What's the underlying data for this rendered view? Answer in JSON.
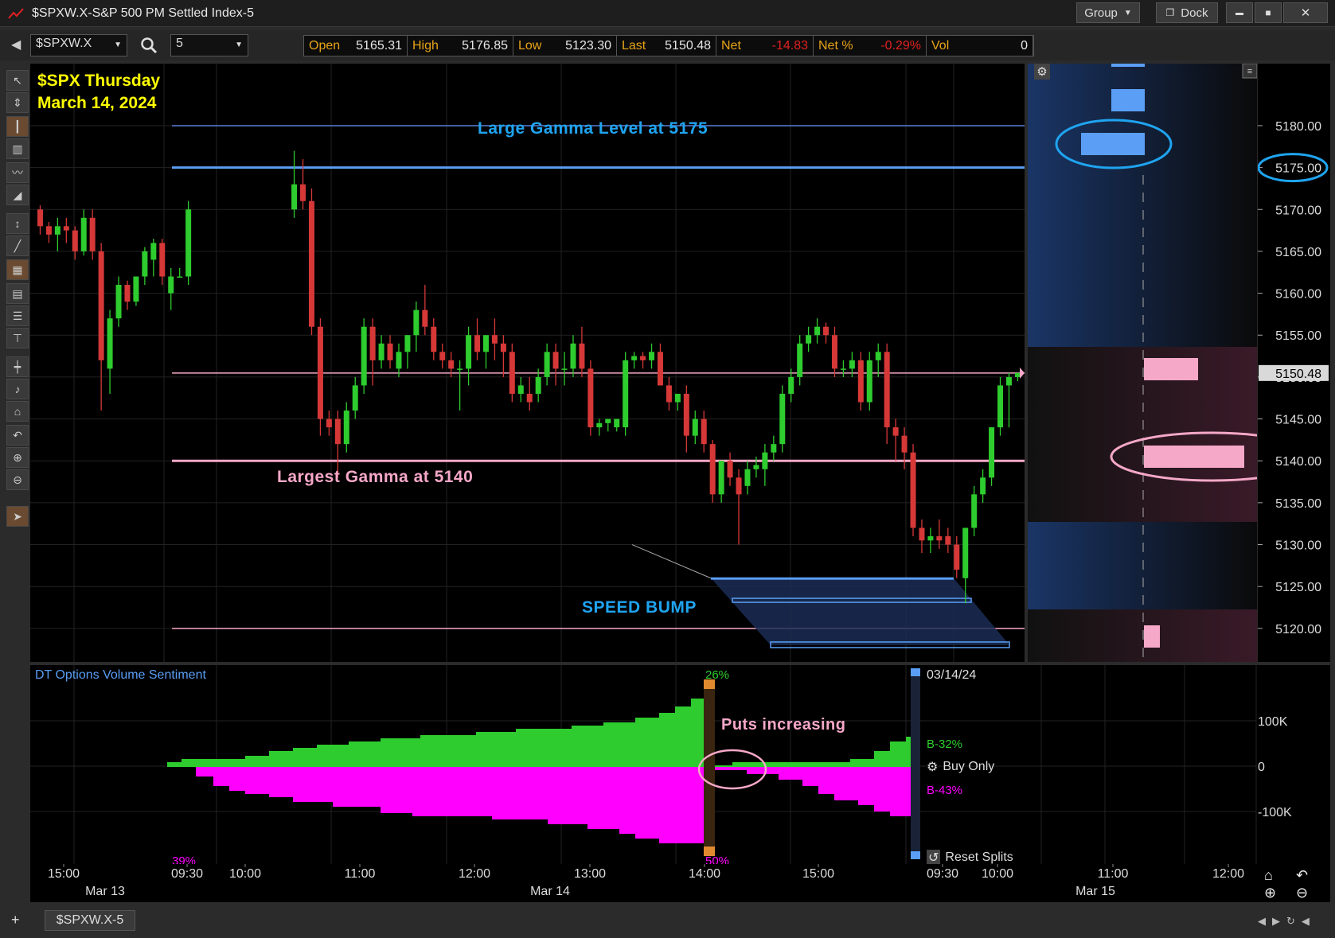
{
  "window": {
    "title": "$SPXW.X-S&P 500 PM Settled Index-5",
    "group_label": "Group",
    "dock_label": "Dock",
    "minimize_glyph": "▬",
    "maximize_glyph": "■",
    "close_glyph": "✕"
  },
  "toolbar": {
    "back_glyph": "◀",
    "symbol": "$SPXW.X",
    "interval": "5",
    "quote": [
      {
        "label": "Open",
        "value": "5165.31"
      },
      {
        "label": "High",
        "value": "5176.85"
      },
      {
        "label": "Low",
        "value": "5123.30"
      },
      {
        "label": "Last",
        "value": "5150.48"
      },
      {
        "label": "Net",
        "value": "-14.83",
        "negative": true
      },
      {
        "label": "Net %",
        "value": "-0.29%",
        "negative": true
      },
      {
        "label": "Vol",
        "value": "0"
      }
    ]
  },
  "annotations": {
    "date_title_line1": "$SPX Thursday",
    "date_title_line2": "March 14, 2024",
    "gamma_5175": "Large Gamma Level at 5175",
    "gamma_5140": "Largest Gamma at 5140",
    "speed_bump": "SPEED BUMP",
    "puts_increasing": "Puts increasing"
  },
  "price_axis": {
    "ticks": [
      "5180.00",
      "5175.00",
      "5170.00",
      "5165.00",
      "5160.00",
      "5155.00",
      "5150.00",
      "5145.00",
      "5140.00",
      "5135.00",
      "5130.00",
      "5125.00",
      "5120.00"
    ],
    "last_price_label": "5150.48"
  },
  "lower_pane": {
    "title": "DT Options Volume Sentiment",
    "pct_top_left": "26%",
    "pct_bottom_left": "50%",
    "pct_39": "39%",
    "date_label": "03/14/24",
    "b_green": "B-32%",
    "b_magenta": "B-43%",
    "buy_only": "Buy Only",
    "reset_splits": "Reset Splits",
    "ticks": [
      "100K",
      "0",
      "-100K"
    ]
  },
  "time_axis": {
    "times": [
      "15:00",
      "09:30",
      "10:00",
      "11:00",
      "12:00",
      "13:00",
      "14:00",
      "15:00",
      "09:30",
      "10:00",
      "11:00",
      "12:00"
    ],
    "dates": [
      "Mar 13",
      "Mar 14",
      "Mar 15"
    ]
  },
  "tabs": {
    "tab1": "$SPXW.X-5"
  },
  "colors": {
    "up": "#2ecc2e",
    "down": "#d63838",
    "gamma_blue": "#5a9ef5",
    "gamma_pink": "#f5a8c8",
    "annotation_blue": "#1fa4f0",
    "annotation_pink": "#f7a8c8",
    "title_yellow": "#ffff00",
    "puts_magenta": "#ff00ff"
  },
  "chart_data": {
    "type": "candlestick",
    "ylim": [
      5116,
      5188
    ],
    "levels": [
      {
        "price": 5180.0,
        "color": "#5a7fd8"
      },
      {
        "price": 5175.0,
        "color": "#5a9ef5"
      },
      {
        "price": 5150.48,
        "color": "#f5a8c8"
      },
      {
        "price": 5140.0,
        "color": "#f5a8c8"
      },
      {
        "price": 5120.0,
        "color": "#f5a8c8"
      }
    ],
    "candles": [
      [
        5170.0,
        5170.5,
        5167.0,
        5168.0
      ],
      [
        5168.0,
        5168.5,
        5166.0,
        5167.0
      ],
      [
        5167.0,
        5169.0,
        5165.0,
        5168.0
      ],
      [
        5168.0,
        5169.0,
        5166.0,
        5167.5
      ],
      [
        5167.5,
        5168.0,
        5164.0,
        5165.0
      ],
      [
        5165.0,
        5170.0,
        5164.5,
        5169.0
      ],
      [
        5169.0,
        5170.0,
        5164.0,
        5165.0
      ],
      [
        5165.0,
        5166.0,
        5146.0,
        5152.0
      ],
      [
        5151.0,
        5158.0,
        5148.0,
        5157.0
      ],
      [
        5157.0,
        5162.0,
        5156.0,
        5161.0
      ],
      [
        5161.0,
        5161.5,
        5158.0,
        5159.0
      ],
      [
        5159.0,
        5162.0,
        5158.5,
        5162.0
      ],
      [
        5162.0,
        5165.5,
        5161.0,
        5165.0
      ],
      [
        5164.0,
        5166.5,
        5162.0,
        5166.0
      ],
      [
        5166.0,
        5166.5,
        5161.0,
        5162.0
      ],
      [
        5160.0,
        5163.0,
        5158.0,
        5162.0
      ],
      [
        5162.0,
        5163.0,
        5162.0,
        5162.0
      ],
      [
        5162.0,
        5171.0,
        5161.0,
        5170.0
      ],
      [
        5170.0,
        5177.0,
        5169.0,
        5173.0
      ],
      [
        5173.0,
        5176.0,
        5170.0,
        5171.0
      ],
      [
        5171.0,
        5172.5,
        5155.0,
        5156.0
      ],
      [
        5156.0,
        5157.0,
        5143.0,
        5145.0
      ],
      [
        5145.0,
        5146.0,
        5143.0,
        5144.0
      ],
      [
        5145.0,
        5146.0,
        5138.0,
        5142.0
      ],
      [
        5142.0,
        5147.0,
        5141.0,
        5146.0
      ],
      [
        5146.0,
        5150.0,
        5145.0,
        5149.0
      ],
      [
        5149.0,
        5157.0,
        5148.0,
        5156.0
      ],
      [
        5156.0,
        5157.0,
        5149.0,
        5152.0
      ],
      [
        5152.0,
        5155.0,
        5151.0,
        5154.0
      ],
      [
        5154.0,
        5155.0,
        5151.0,
        5152.0
      ],
      [
        5151.0,
        5154.0,
        5150.0,
        5153.0
      ],
      [
        5153.0,
        5155.0,
        5151.0,
        5155.0
      ],
      [
        5155.0,
        5159.0,
        5153.0,
        5158.0
      ],
      [
        5158.0,
        5161.0,
        5155.0,
        5156.0
      ],
      [
        5156.0,
        5157.0,
        5152.0,
        5153.0
      ],
      [
        5153.0,
        5154.0,
        5151.0,
        5152.0
      ],
      [
        5152.0,
        5153.0,
        5150.0,
        5151.0
      ],
      [
        5151.0,
        5152.0,
        5146.0,
        5151.0
      ],
      [
        5151.0,
        5156.0,
        5149.0,
        5155.0
      ],
      [
        5155.0,
        5157.0,
        5152.0,
        5153.0
      ],
      [
        5153.0,
        5155.0,
        5151.0,
        5155.0
      ],
      [
        5155.0,
        5157.0,
        5152.0,
        5154.0
      ],
      [
        5154.0,
        5155.0,
        5150.0,
        5153.0
      ],
      [
        5153.0,
        5154.0,
        5147.0,
        5148.0
      ],
      [
        5148.0,
        5150.0,
        5147.0,
        5149.0
      ],
      [
        5148.0,
        5150.0,
        5146.0,
        5147.0
      ],
      [
        5148.0,
        5151.0,
        5147.0,
        5150.0
      ],
      [
        5150.0,
        5154.0,
        5149.0,
        5153.0
      ],
      [
        5153.0,
        5154.0,
        5149.0,
        5151.0
      ],
      [
        5151.0,
        5153.0,
        5149.0,
        5151.0
      ],
      [
        5151.0,
        5155.0,
        5150.0,
        5154.0
      ],
      [
        5154.0,
        5156.0,
        5150.0,
        5151.0
      ],
      [
        5151.0,
        5152.0,
        5143.0,
        5144.0
      ],
      [
        5144.0,
        5145.0,
        5143.0,
        5144.5
      ],
      [
        5144.5,
        5145.0,
        5143.5,
        5145.0
      ],
      [
        5144.0,
        5145.0,
        5143.5,
        5145.0
      ],
      [
        5144.0,
        5153.0,
        5143.0,
        5152.0
      ],
      [
        5152.0,
        5153.0,
        5151.0,
        5152.5
      ],
      [
        5152.5,
        5153.0,
        5151.0,
        5152.0
      ],
      [
        5152.0,
        5154.0,
        5151.0,
        5153.0
      ],
      [
        5153.0,
        5154.0,
        5149.0,
        5149.0
      ],
      [
        5149.0,
        5150.0,
        5146.0,
        5147.0
      ],
      [
        5147.0,
        5148.0,
        5146.0,
        5148.0
      ],
      [
        5148.0,
        5149.0,
        5141.0,
        5143.0
      ],
      [
        5143.0,
        5146.0,
        5142.0,
        5145.0
      ],
      [
        5145.0,
        5146.0,
        5141.0,
        5142.0
      ],
      [
        5142.0,
        5142.5,
        5135.0,
        5136.0
      ],
      [
        5136.0,
        5140.0,
        5135.0,
        5140.0
      ],
      [
        5140.0,
        5141.0,
        5137.0,
        5138.0
      ],
      [
        5138.0,
        5139.0,
        5130.0,
        5136.0
      ],
      [
        5137.0,
        5140.0,
        5136.0,
        5139.0
      ],
      [
        5139.0,
        5140.5,
        5138.0,
        5139.5
      ],
      [
        5139.0,
        5142.0,
        5137.0,
        5141.0
      ],
      [
        5141.0,
        5143.0,
        5140.0,
        5142.0
      ],
      [
        5142.0,
        5149.0,
        5141.0,
        5148.0
      ],
      [
        5148.0,
        5151.0,
        5147.0,
        5150.0
      ],
      [
        5150.0,
        5155.0,
        5149.0,
        5154.0
      ],
      [
        5154.0,
        5156.0,
        5153.0,
        5155.0
      ],
      [
        5155.0,
        5157.0,
        5154.0,
        5156.0
      ],
      [
        5156.0,
        5156.5,
        5154.0,
        5155.0
      ],
      [
        5155.0,
        5156.0,
        5150.0,
        5151.0
      ],
      [
        5151.0,
        5152.0,
        5150.0,
        5151.0
      ],
      [
        5151.0,
        5153.0,
        5150.0,
        5152.0
      ],
      [
        5152.0,
        5153.0,
        5146.0,
        5147.0
      ],
      [
        5147.0,
        5153.0,
        5146.0,
        5152.0
      ],
      [
        5152.0,
        5154.0,
        5150.0,
        5153.0
      ],
      [
        5153.0,
        5154.0,
        5142.0,
        5144.0
      ],
      [
        5144.0,
        5145.0,
        5140.0,
        5143.0
      ],
      [
        5143.0,
        5144.0,
        5139.0,
        5141.0
      ],
      [
        5141.0,
        5142.0,
        5131.0,
        5132.0
      ],
      [
        5132.0,
        5133.0,
        5129.0,
        5130.5
      ],
      [
        5130.5,
        5132.0,
        5129.0,
        5131.0
      ],
      [
        5131.0,
        5133.0,
        5129.5,
        5130.5
      ],
      [
        5131.0,
        5132.0,
        5129.0,
        5130.0
      ],
      [
        5130.0,
        5131.0,
        5126.0,
        5127.0
      ],
      [
        5126.0,
        5132.0,
        5123.0,
        5132.0
      ],
      [
        5132.0,
        5137.0,
        5131.0,
        5136.0
      ],
      [
        5136.0,
        5139.0,
        5135.0,
        5138.0
      ],
      [
        5138.0,
        5144.0,
        5137.0,
        5144.0
      ],
      [
        5144.0,
        5150.0,
        5143.0,
        5149.0
      ],
      [
        5149.0,
        5150.5,
        5144.0,
        5150.0
      ],
      [
        5150.0,
        5150.5,
        5149.5,
        5150.48
      ]
    ],
    "speed_bump_zone": [
      5126.0,
      5118.0
    ]
  }
}
